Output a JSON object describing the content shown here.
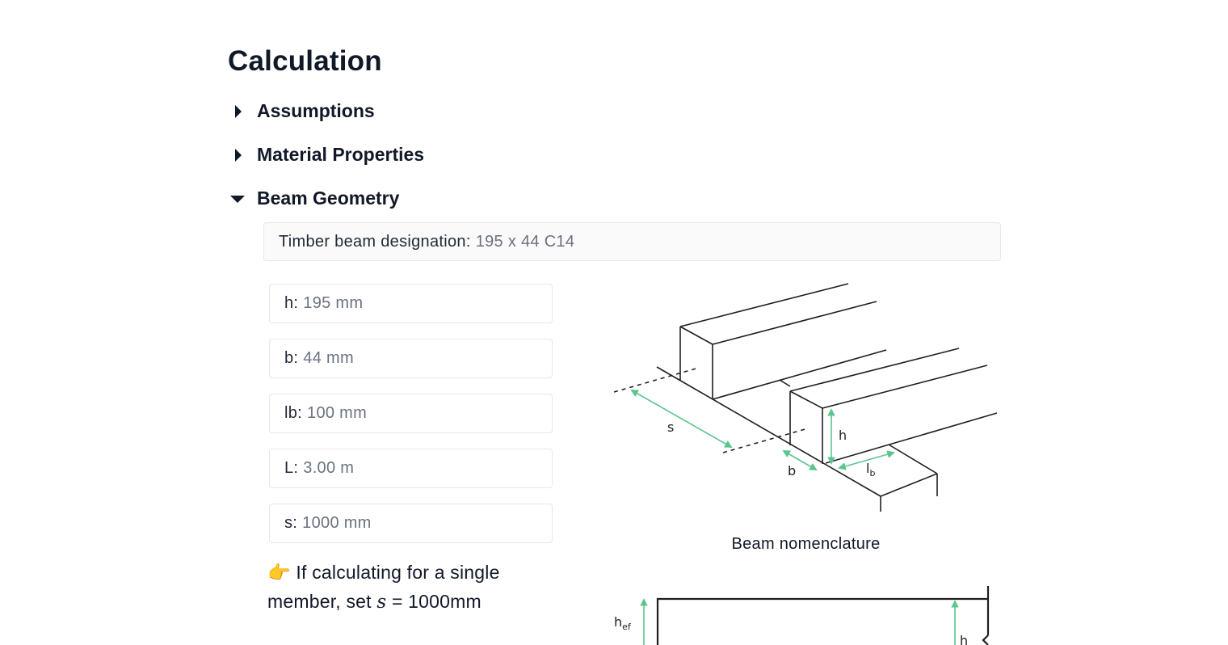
{
  "title": "Calculation",
  "sections": [
    {
      "label": "Assumptions",
      "expanded": false
    },
    {
      "label": "Material Properties",
      "expanded": false
    },
    {
      "label": "Beam Geometry",
      "expanded": true
    }
  ],
  "beam_geometry": {
    "designation": {
      "label": "Timber beam designation:",
      "value": "195 x 44 C14"
    },
    "fields": [
      {
        "label": "h:",
        "value": "195 mm"
      },
      {
        "label": "b:",
        "value": "44 mm"
      },
      {
        "label": "lb:",
        "value": "100 mm"
      },
      {
        "label": "L:",
        "value": "3.00 m"
      },
      {
        "label": "s:",
        "value": "1000 mm"
      }
    ],
    "note": {
      "icon": "pointing-hand-icon",
      "emoji": "👉",
      "text_before": " If calculating for a single member, set ",
      "math": "s",
      "text_after": " = 1000mm"
    },
    "diagram_labels": {
      "s": "s",
      "h": "h",
      "b": "b",
      "lb": "l",
      "lb_sub": "b"
    },
    "caption": "Beam nomenclature",
    "diagram2_labels": {
      "hef": "h",
      "hef_sub": "ef",
      "h": "h"
    }
  },
  "colors": {
    "accent_green": "#5cc48f",
    "text": "#111827",
    "muted": "#6b7280",
    "border": "#e5e7eb"
  }
}
